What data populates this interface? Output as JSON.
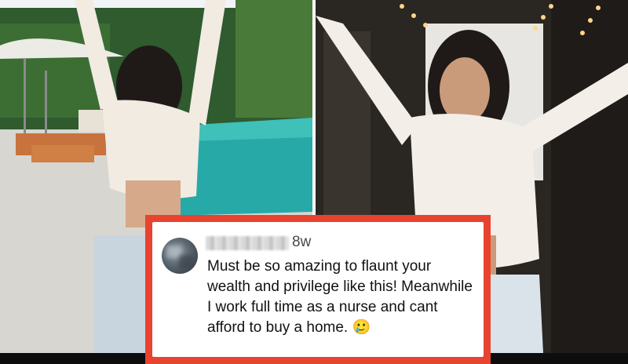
{
  "left_photo": {
    "icon": "poolside-dancer-photo",
    "colors": {
      "sky": "#f1f4f6",
      "hedge": "#2f5b2e",
      "pool": "#27a9a8",
      "deck": "#d8d6d1"
    }
  },
  "right_photo": {
    "icon": "hallway-pose-photo",
    "colors": {
      "wall": "#2a2622",
      "lights": "#ffd58a",
      "top": "#f3efe8",
      "jeans": "#dbe3ea"
    }
  },
  "comment": {
    "username_blurred": true,
    "timestamp": "8w",
    "text": "Must be so amazing to flaunt your wealth and privilege like this! Meanwhile I work full time as a nurse and cant afford to buy a home. 🥲",
    "accent_color": "#e8432f"
  }
}
